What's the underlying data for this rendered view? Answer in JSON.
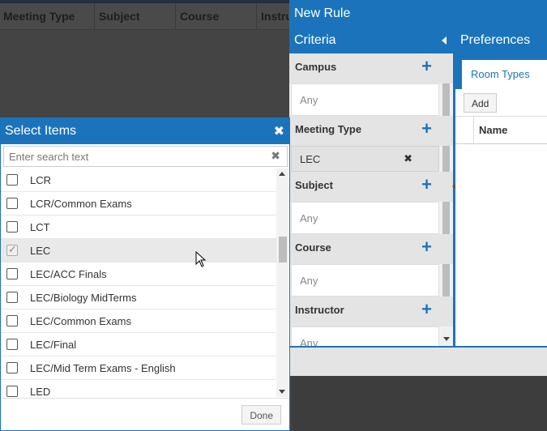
{
  "background_table": {
    "columns": [
      "Meeting Type",
      "Subject",
      "Course",
      "Instru"
    ]
  },
  "new_rule": {
    "title": "New Rule",
    "criteria": {
      "title": "Criteria",
      "sections": [
        {
          "label": "Campus",
          "value": "Any",
          "type": "placeholder"
        },
        {
          "label": "Meeting Type",
          "value": "LEC",
          "type": "chip"
        },
        {
          "label": "Subject",
          "value": "Any",
          "type": "placeholder"
        },
        {
          "label": "Course",
          "value": "Any",
          "type": "placeholder"
        },
        {
          "label": "Instructor",
          "value": "Any",
          "type": "placeholder"
        }
      ]
    },
    "preferences": {
      "title": "Preferences",
      "tab": "Room Types",
      "add_label": "Add",
      "grid_column": "Name"
    }
  },
  "select_items": {
    "title": "Select Items",
    "search_placeholder": "Enter search text",
    "items": [
      {
        "label": "LCR",
        "checked": false
      },
      {
        "label": "LCR/Common Exams",
        "checked": false
      },
      {
        "label": "LCT",
        "checked": false
      },
      {
        "label": "LEC",
        "checked": true
      },
      {
        "label": "LEC/ACC Finals",
        "checked": false
      },
      {
        "label": "LEC/Biology MidTerms",
        "checked": false
      },
      {
        "label": "LEC/Common Exams",
        "checked": false
      },
      {
        "label": "LEC/Final",
        "checked": false
      },
      {
        "label": "LEC/Mid Term Exams - English",
        "checked": false
      },
      {
        "label": "LED",
        "checked": false
      }
    ],
    "done_label": "Done"
  },
  "icons": {
    "close": "close-icon",
    "plus": "plus-icon",
    "collapse": "chevron-left-icon",
    "remove": "remove-x-icon"
  },
  "colors": {
    "accent": "#1b74bb",
    "selected_row": "#e9e9e9"
  }
}
